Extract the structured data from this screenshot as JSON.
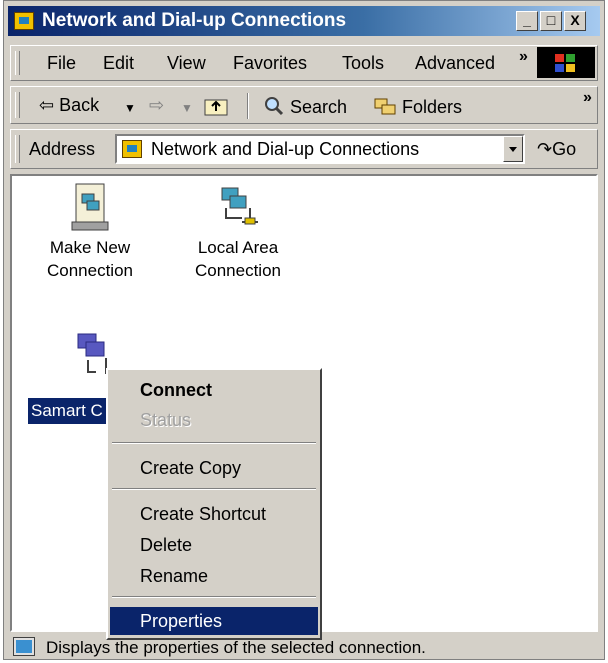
{
  "window": {
    "title": "Network and Dial-up Connections",
    "controls": {
      "minimize": "_",
      "maximize": "□",
      "close": "X"
    }
  },
  "menubar": {
    "items": [
      "File",
      "Edit",
      "View",
      "Favorites",
      "Tools",
      "Advanced"
    ],
    "overflow": "»"
  },
  "toolbar": {
    "back": "Back",
    "search": "Search",
    "folders": "Folders",
    "overflow": "»"
  },
  "addressbar": {
    "label": "Address",
    "value": "Network and Dial-up Connections",
    "go": "Go"
  },
  "icons": [
    {
      "line1": "Make New",
      "line2": "Connection"
    },
    {
      "line1": "Local Area",
      "line2": "Connection"
    },
    {
      "label": "Samart C"
    }
  ],
  "context_menu": {
    "items": [
      "Connect",
      "Status",
      "Create Copy",
      "Create Shortcut",
      "Delete",
      "Rename",
      "Properties"
    ],
    "default_item": "Connect",
    "disabled_item": "Status",
    "highlighted_item": "Properties"
  },
  "statusbar": {
    "text": "Displays the properties of the selected connection."
  }
}
